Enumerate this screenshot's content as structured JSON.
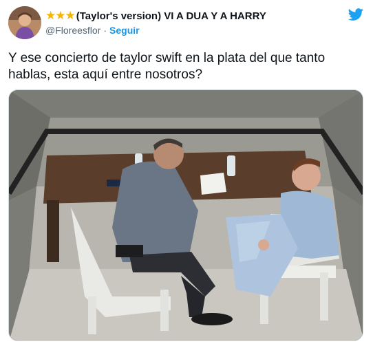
{
  "header": {
    "stars": "★★★",
    "display_name": "(Taylor's version) VI A DUA Y A HARRY",
    "handle": "@Floreesflor",
    "separator": "·",
    "follow_label": "Seguir"
  },
  "tweet": {
    "text": "Y ese concierto de taylor swift en la plata del que tanto hablas, esta aquí entre nosotros?"
  },
  "colors": {
    "accent": "#1b95e0",
    "star": "#f4b400",
    "text": "#0f1419",
    "muted": "#536471"
  },
  "icons": {
    "brand": "twitter-bird-icon",
    "rating": "star-icon"
  }
}
